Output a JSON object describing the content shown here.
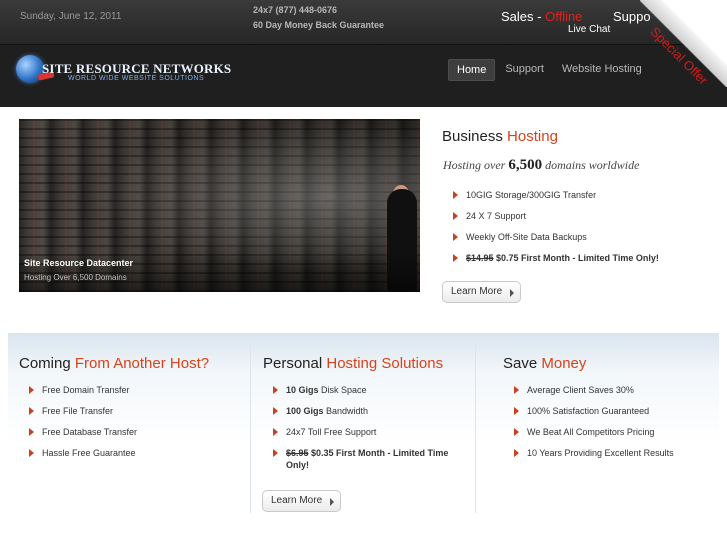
{
  "topbar": {
    "date": "Sunday, June 12, 2011",
    "phone": "24x7 (877) 448-0676",
    "guarantee": "60 Day Money Back Guarantee",
    "sales_label": "Sales - ",
    "sales_status": "Offline",
    "live_chat": "Live Chat",
    "support_label": "Suppo",
    "special_offer": "Special Offer"
  },
  "logo": {
    "name": "SITE RESOURCE NETWORKS",
    "tagline": "WORLD WIDE WEBSITE SOLUTIONS"
  },
  "nav": {
    "items": [
      {
        "label": "Home"
      },
      {
        "label": "Support"
      },
      {
        "label": "Website Hosting"
      }
    ]
  },
  "hero": {
    "image_caption_title": "Site Resource Datacenter",
    "image_caption_sub": "Hosting Over 6,500 Domains",
    "title_plain": "Business ",
    "title_highlight": "Hosting",
    "subtitle_pre": "Hosting over ",
    "subtitle_num": "6,500",
    "subtitle_post": " domains worldwide",
    "features": [
      "10GIG Storage/300GIG Transfer",
      "24 X 7 Support",
      "Weekly Off-Site Data Backups"
    ],
    "price_old": "$14.95",
    "price_new": " $0.75 First Month - Limited Time Only!",
    "learn_more": "Learn More"
  },
  "columns": {
    "col1": {
      "title_plain": "Coming ",
      "title_highlight": "From Another Host?",
      "items": [
        "Free Domain Transfer",
        "Free File Transfer",
        "Free Database Transfer",
        "Hassle Free Guarantee"
      ]
    },
    "col2": {
      "title_plain": "Personal ",
      "title_highlight": "Hosting Solutions",
      "item1_bold": "10 Gigs",
      "item1_rest": " Disk Space",
      "item2_bold": "100 Gigs",
      "item2_rest": " Bandwidth",
      "item3": "24x7 Toll Free Support",
      "price_old": "$6.95",
      "price_new_line1": " $0.35 First Month - Limited Time",
      "price_new_line2": "Only!",
      "learn_more": "Learn More"
    },
    "col3": {
      "title_plain": "Save ",
      "title_highlight": "Money",
      "items": [
        "Average Client Saves 30%",
        "100% Satisfaction Guaranteed",
        "We Beat All Competitors Pricing",
        "10 Years Providing Excellent Results"
      ]
    }
  },
  "colors": {
    "accent": "#d7431b",
    "offline": "#e02020",
    "header_bg": "#1f1f1f"
  }
}
